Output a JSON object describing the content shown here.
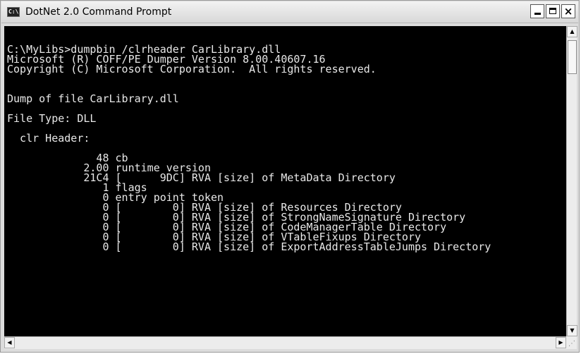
{
  "window": {
    "title": "DotNet 2.0 Command Prompt",
    "icon_text": "C:\\",
    "minimize_label": "_",
    "close_label": "×"
  },
  "console": {
    "lines": [
      "C:\\MyLibs>dumpbin /clrheader CarLibrary.dll",
      "Microsoft (R) COFF/PE Dumper Version 8.00.40607.16",
      "Copyright (C) Microsoft Corporation.  All rights reserved.",
      "",
      "",
      "Dump of file CarLibrary.dll",
      "",
      "File Type: DLL",
      "",
      "  clr Header:",
      "",
      "              48 cb",
      "            2.00 runtime version",
      "            21C4 [      9DC] RVA [size] of MetaData Directory",
      "               1 flags",
      "               0 entry point token",
      "               0 [        0] RVA [size] of Resources Directory",
      "               0 [        0] RVA [size] of StrongNameSignature Directory",
      "               0 [        0] RVA [size] of CodeManagerTable Directory",
      "               0 [        0] RVA [size] of VTableFixups Directory",
      "               0 [        0] RVA [size] of ExportAddressTableJumps Directory"
    ]
  },
  "scrollbars": {
    "up_arrow": "▲",
    "down_arrow": "▼",
    "left_arrow": "◀",
    "right_arrow": "▶",
    "grip": "⋰"
  }
}
